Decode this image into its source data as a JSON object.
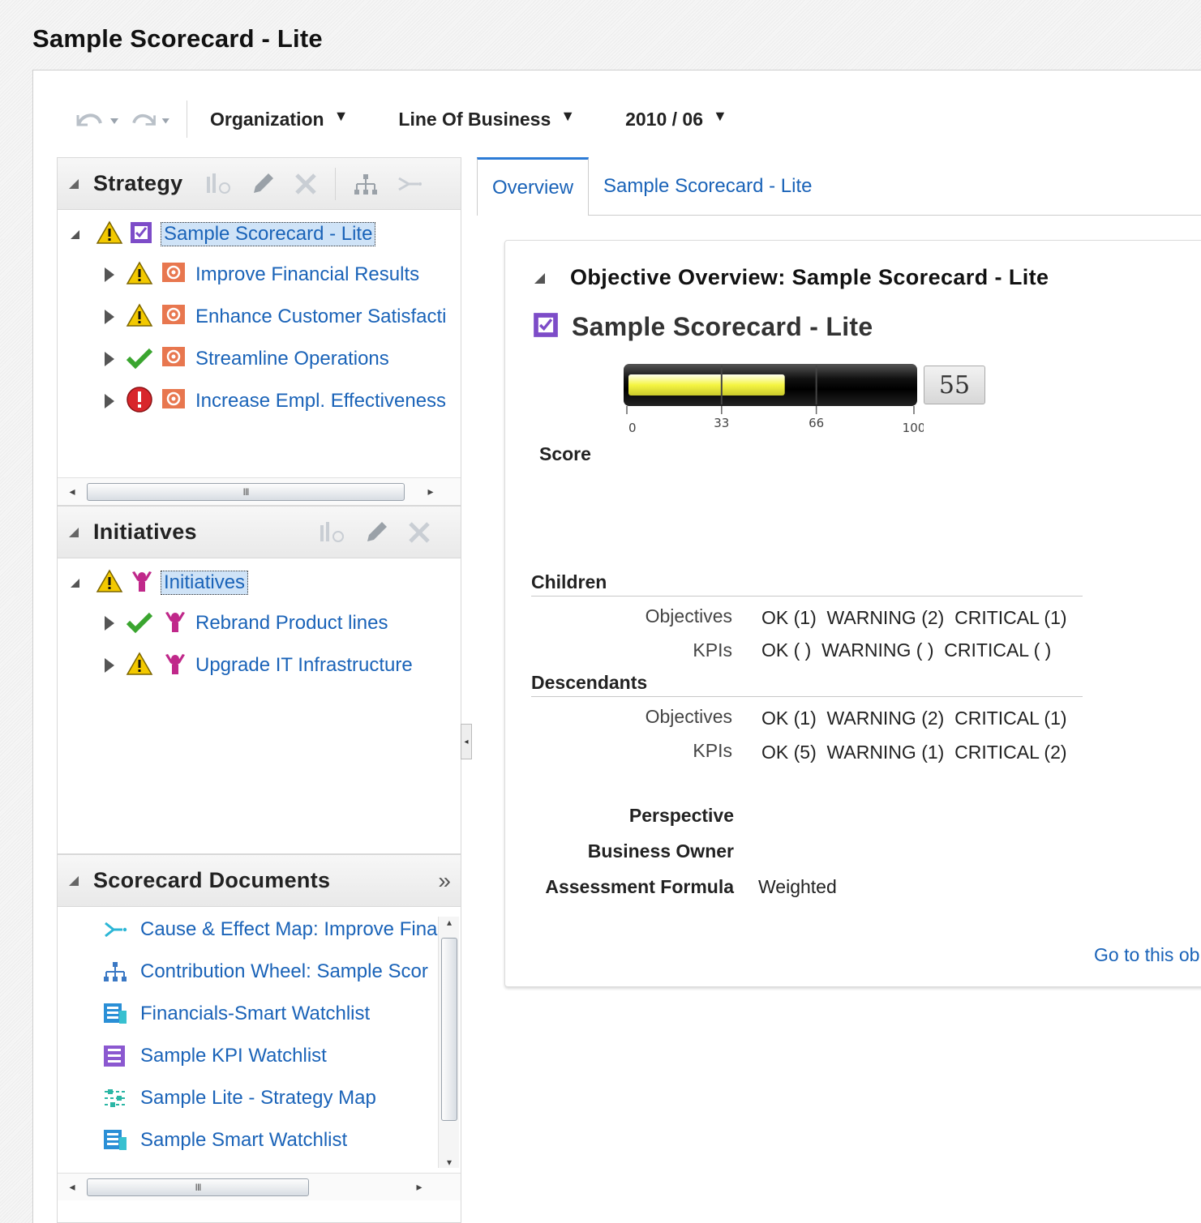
{
  "page": {
    "title": "Sample Scorecard - Lite"
  },
  "toolbar": {
    "undo_icon": "undo-icon",
    "redo_icon": "redo-icon",
    "dropdowns": [
      {
        "label": "Organization"
      },
      {
        "label": "Line Of Business"
      },
      {
        "label": "2010 / 06"
      }
    ]
  },
  "strategy": {
    "title": "Strategy",
    "root": {
      "label": "Sample Scorecard - Lite",
      "status": "warning",
      "icon": "scorecard-icon"
    },
    "items": [
      {
        "label": "Improve Financial Results",
        "status": "warning",
        "icon": "objective-icon"
      },
      {
        "label": "Enhance Customer Satisfacti",
        "status": "warning",
        "icon": "objective-icon"
      },
      {
        "label": "Streamline Operations",
        "status": "ok",
        "icon": "objective-icon"
      },
      {
        "label": "Increase Empl. Effectiveness",
        "status": "critical",
        "icon": "objective-icon"
      }
    ]
  },
  "initiatives": {
    "title": "Initiatives",
    "root": {
      "label": "Initiatives",
      "status": "warning",
      "icon": "initiative-icon"
    },
    "items": [
      {
        "label": "Rebrand Product lines",
        "status": "ok",
        "icon": "initiative-icon"
      },
      {
        "label": "Upgrade IT Infrastructure",
        "status": "warning",
        "icon": "initiative-icon"
      }
    ]
  },
  "documents": {
    "title": "Scorecard Documents",
    "expand_glyph": "»",
    "items": [
      {
        "label": "Cause & Effect Map: Improve Fina",
        "icon": "cause-effect-map-icon"
      },
      {
        "label": "Contribution Wheel: Sample Scor",
        "icon": "contribution-wheel-icon"
      },
      {
        "label": "Financials-Smart Watchlist",
        "icon": "smart-watchlist-icon"
      },
      {
        "label": "Sample KPI Watchlist",
        "icon": "kpi-watchlist-icon"
      },
      {
        "label": "Sample Lite - Strategy Map",
        "icon": "strategy-map-icon"
      },
      {
        "label": "Sample Smart Watchlist",
        "icon": "smart-watchlist-icon"
      }
    ]
  },
  "tabs": [
    {
      "label": "Overview",
      "active": true
    },
    {
      "label": "Sample Scorecard - Lite",
      "active": false
    }
  ],
  "overview": {
    "section_title": "Objective Overview: Sample Scorecard - Lite",
    "objective_name": "Sample Scorecard - Lite",
    "gauge": {
      "value": 55,
      "min": 0,
      "max": 100,
      "ticks": [
        "0",
        "33",
        "66",
        "100"
      ],
      "display": "55",
      "fill_color": "#f5f542"
    },
    "score_label": "Score",
    "children": {
      "label": "Children",
      "rows": [
        {
          "label": "Objectives",
          "value": "OK (1)  WARNING (2)  CRITICAL (1)"
        },
        {
          "label": "KPIs",
          "value": "OK ( )  WARNING ( )  CRITICAL ( )"
        }
      ]
    },
    "descendants": {
      "label": "Descendants",
      "rows": [
        {
          "label": "Objectives",
          "value": "OK (1)  WARNING (2)  CRITICAL (1)"
        },
        {
          "label": "KPIs",
          "value": "OK (5)  WARNING (1)  CRITICAL (2)"
        }
      ]
    },
    "properties": [
      {
        "label": "Perspective",
        "value": ""
      },
      {
        "label": "Business Owner",
        "value": ""
      },
      {
        "label": "Assessment Formula",
        "value": "Weighted"
      }
    ],
    "goto_link": "Go to this ob"
  },
  "colors": {
    "link": "#1a63b8",
    "warning": "#f3c900",
    "ok": "#3aa52f",
    "critical": "#d8262b",
    "objective_icon": "#e8774f",
    "scorecard_icon": "#7d4cc8",
    "initiative_icon": "#c0288a"
  }
}
